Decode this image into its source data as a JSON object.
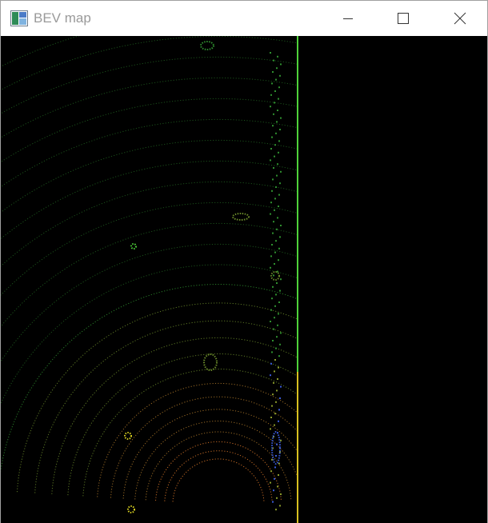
{
  "window": {
    "title": "BEV map",
    "controls": {
      "minimize_icon": "minimize-icon",
      "maximize_icon": "maximize-icon",
      "close_icon": "close-icon"
    },
    "app_icon": "window-app-icon"
  },
  "bev_map": {
    "background": "#000000",
    "description_colors": {
      "near_points": "#e07a2a",
      "mid_points": "#6a8a2a",
      "far_points": "#2f8f2f",
      "wall_line": "#4fd23a",
      "object_highlight": "#d8d020",
      "blue_points": "#3a5bd8"
    }
  }
}
